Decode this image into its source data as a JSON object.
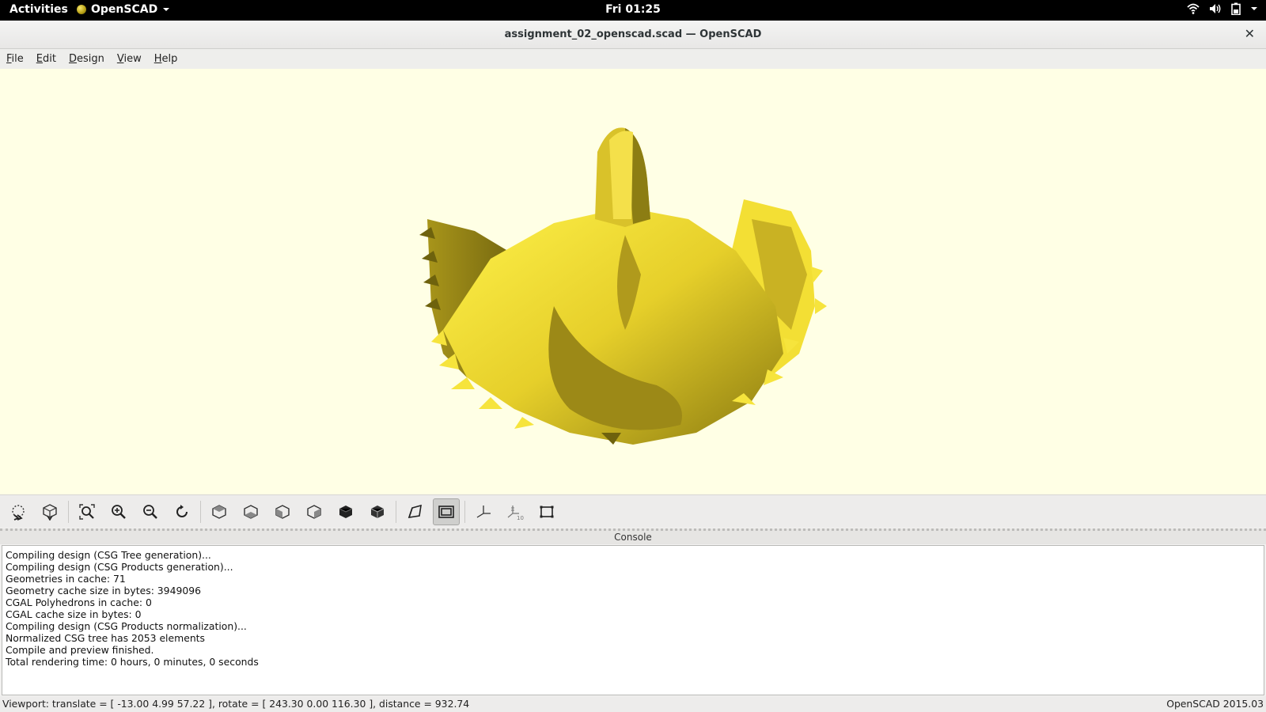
{
  "topbar": {
    "activities": "Activities",
    "app_name": "OpenSCAD",
    "clock": "Fri 01:25",
    "icons": [
      "wifi-icon",
      "volume-icon",
      "battery-icon",
      "chevron-down-icon"
    ]
  },
  "window": {
    "title": "assignment_02_openscad.scad — OpenSCAD",
    "close_glyph": "✕"
  },
  "menu": {
    "items": [
      {
        "mnemonic": "F",
        "rest": "ile"
      },
      {
        "mnemonic": "E",
        "rest": "dit"
      },
      {
        "mnemonic": "D",
        "rest": "esign"
      },
      {
        "mnemonic": "V",
        "rest": "iew"
      },
      {
        "mnemonic": "H",
        "rest": "elp"
      }
    ]
  },
  "viewport": {
    "background": "#ffffe5",
    "model_color_light": "#f5e33a",
    "model_color_dark": "#8a7a10"
  },
  "toolbar": {
    "buttons": [
      "preview-icon",
      "render-icon",
      "view-all-icon",
      "zoom-in-icon",
      "zoom-out-icon",
      "reset-view-icon",
      "view-top-icon",
      "view-bottom-icon",
      "view-left-icon",
      "view-right-icon",
      "view-front-icon",
      "view-back-icon",
      "perspective-icon",
      "orthogonal-icon",
      "show-axes-icon",
      "show-scale-markers-icon",
      "show-edges-icon"
    ],
    "active": "orthogonal-icon"
  },
  "console": {
    "header": "Console",
    "lines": [
      "Compiling design (CSG Tree generation)...",
      "Compiling design (CSG Products generation)...",
      "Geometries in cache: 71",
      "Geometry cache size in bytes: 3949096",
      "CGAL Polyhedrons in cache: 0",
      "CGAL cache size in bytes: 0",
      "Compiling design (CSG Products normalization)...",
      "Normalized CSG tree has 2053 elements",
      "Compile and preview finished.",
      "Total rendering time: 0 hours, 0 minutes, 0 seconds"
    ]
  },
  "status": {
    "viewport_info": "Viewport: translate = [ -13.00 4.99 57.22 ], rotate = [ 243.30 0.00 116.30 ], distance = 932.74",
    "version": "OpenSCAD 2015.03"
  }
}
